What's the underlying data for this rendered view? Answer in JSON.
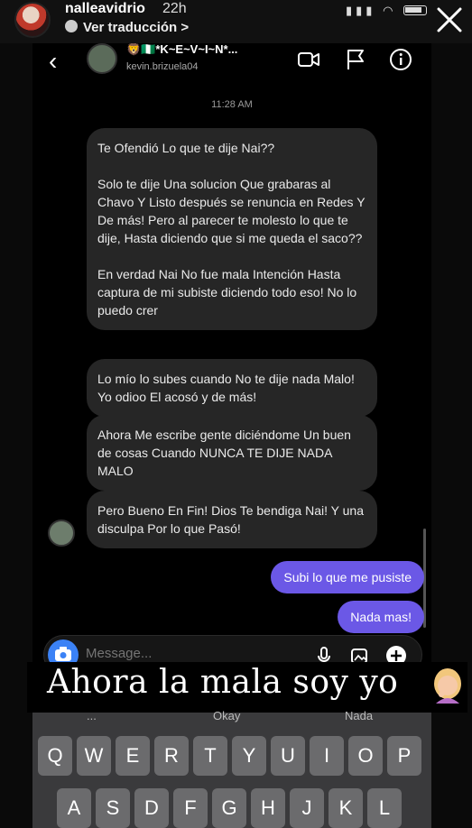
{
  "story": {
    "username": "nalleavidrio",
    "time": "22h",
    "translate_label": "Ver traducción",
    "translate_chevron": ">",
    "close_icon": "close-icon"
  },
  "dm": {
    "contact_name": "🦁🇳🇬*K~E~V~I~N*...",
    "contact_handle": "kevin.brizuela04",
    "back_icon": "chevron-left-icon",
    "icons": [
      "video-call-icon",
      "flag-icon",
      "info-icon"
    ]
  },
  "chat": {
    "timestamp": "11:28 AM",
    "incoming": [
      {
        "paragraphs": [
          "Te Ofendió Lo que te dije Nai??",
          "Solo te dije Una solucion Que grabaras al Chavo Y Listo después se renuncia en Redes Y De más! Pero al parecer te molesto lo que te dije, Hasta diciendo que si me queda el saco??",
          "En verdad Nai No fue mala Intención Hasta captura de mi subiste diciendo todo eso! No lo puedo crer"
        ]
      },
      {
        "paragraphs": [
          "Lo mío lo subes cuando No te dije nada Malo! Yo odioo El acosó y de más!"
        ]
      },
      {
        "paragraphs": [
          "Ahora Me escribe gente diciéndome Un buen de cosas Cuando NUNCA TE DIJE NADA MALO"
        ]
      },
      {
        "paragraphs": [
          "Pero Bueno En Fin! Dios Te bendiga Nai! Y una disculpa Por lo que Pasó!"
        ]
      }
    ],
    "outgoing": [
      "Subi lo que me pusiste",
      "Nada mas!"
    ]
  },
  "composer": {
    "placeholder": "Message...",
    "icons": [
      "camera-icon",
      "microphone-icon",
      "gallery-icon",
      "add-icon"
    ]
  },
  "caption": {
    "text": "Ahora la mala soy yo",
    "emoji": "person-facepalming-emoji"
  },
  "keyboard": {
    "predictions": [
      "...",
      "Okay",
      "Nada"
    ],
    "row1": [
      "Q",
      "W",
      "E",
      "R",
      "T",
      "Y",
      "U",
      "I",
      "O",
      "P"
    ],
    "row2": [
      "A",
      "S",
      "D",
      "F",
      "G",
      "H",
      "J",
      "K",
      "L"
    ]
  },
  "colors": {
    "incoming_bubble": "#262626",
    "outgoing_bubble": "#6b58e6",
    "camera_button": "#3b82f6",
    "keyboard_bg": "#3a3a3c",
    "key_bg": "#6b6b6d"
  }
}
